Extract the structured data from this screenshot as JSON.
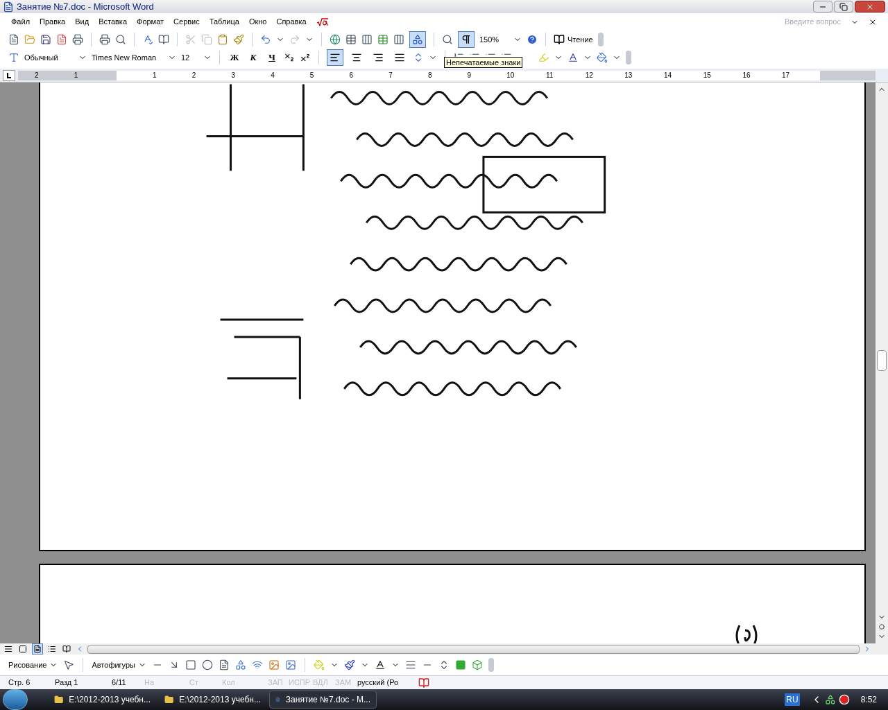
{
  "window": {
    "title": "Занятие №7.doc - Microsoft Word"
  },
  "menu": [
    "Файл",
    "Правка",
    "Вид",
    "Вставка",
    "Формат",
    "Сервис",
    "Таблица",
    "Окно",
    "Справка"
  ],
  "help_box": {
    "placeholder": "Введите вопрос"
  },
  "standard_toolbar": {
    "zoom": "150%",
    "reading_button": "Чтение",
    "show_marks_selected": true,
    "drawing_selected": true
  },
  "formatting_toolbar": {
    "style": "Обычный",
    "font": "Times New Roman",
    "size": "12",
    "format_buttons": [
      {
        "label": "Ж",
        "kind": "bold"
      },
      {
        "label": "К",
        "kind": "italic"
      },
      {
        "label": "Ч",
        "kind": "underline"
      }
    ],
    "align_buttons": [
      {
        "selected": true
      },
      {
        "selected": false
      },
      {
        "selected": false
      },
      {
        "selected": false
      }
    ]
  },
  "tooltip": "Непечатаемые знаки",
  "ruler": [
    "2",
    "1",
    "1",
    "2",
    "3",
    "4",
    "5",
    "6",
    "7",
    "8",
    "9",
    "10",
    "11",
    "12",
    "13",
    "14",
    "15",
    "16",
    "17"
  ],
  "view_buttons": [
    {
      "selected": false
    },
    {
      "selected": false
    },
    {
      "selected": true
    },
    {
      "selected": false
    },
    {
      "selected": false
    }
  ],
  "drawing_toolbar": {
    "drawing_menu": "Рисование",
    "autoshapes_menu": "Автофигуры"
  },
  "status_bar": [
    {
      "text": "Стр. 6",
      "disabled": false
    },
    {
      "text": "Разд 1",
      "disabled": false
    },
    {
      "text": "6/11",
      "disabled": false
    },
    {
      "text": "На",
      "disabled": true
    },
    {
      "text": "Ст",
      "disabled": true
    },
    {
      "text": "Кол",
      "disabled": true
    },
    {
      "text": "ЗАП",
      "disabled": true
    },
    {
      "text": "ИСПР",
      "disabled": true
    },
    {
      "text": "ВДЛ",
      "disabled": true
    },
    {
      "text": "ЗАМ",
      "disabled": true
    },
    {
      "text": "русский (Ро",
      "disabled": false
    }
  ],
  "taskbar": {
    "items": [
      {
        "label": "E:\\2012-2013 учебн...",
        "selected": false
      },
      {
        "label": "E:\\2012-2013 учебн...",
        "selected": false
      },
      {
        "label": "Занятие №7.doc - М...",
        "selected": true
      }
    ],
    "language": "RU",
    "clock": "8:52"
  }
}
